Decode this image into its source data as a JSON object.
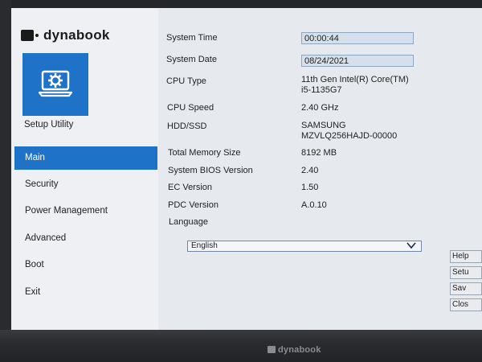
{
  "brand": {
    "name": "dynabook"
  },
  "sidebar": {
    "tile_icon": "settings-laptop-icon",
    "title": "Setup Utility",
    "items": [
      {
        "label": "Main",
        "active": true
      },
      {
        "label": "Security"
      },
      {
        "label": "Power Management"
      },
      {
        "label": "Advanced"
      },
      {
        "label": "Boot"
      },
      {
        "label": "Exit"
      }
    ]
  },
  "main": {
    "system_time": {
      "label": "System Time",
      "value": "00:00:44"
    },
    "system_date": {
      "label": "System Date",
      "value": "08/24/2021"
    },
    "cpu_type": {
      "label": "CPU Type",
      "value_line1": "11th Gen Intel(R) Core(TM)",
      "value_line2": "i5-1135G7"
    },
    "cpu_speed": {
      "label": "CPU Speed",
      "value": "2.40 GHz"
    },
    "storage": {
      "label": "HDD/SSD",
      "value_line1": "SAMSUNG",
      "value_line2": "MZVLQ256HAJD-00000"
    },
    "memory": {
      "label": "Total Memory Size",
      "value": "8192 MB"
    },
    "bios": {
      "label": "System BIOS Version",
      "value": "2.40"
    },
    "ec": {
      "label": "EC Version",
      "value": "1.50"
    },
    "pdc": {
      "label": "PDC Version",
      "value": "A.0.10"
    },
    "language": {
      "label": "Language",
      "selected": "English"
    }
  },
  "side_buttons": [
    "Help",
    "Setu",
    "Sav",
    "Clos"
  ],
  "colors": {
    "accent": "#1e73c8",
    "main_bg": "#e6e9ee",
    "sidebar_bg": "#eef0f4"
  }
}
